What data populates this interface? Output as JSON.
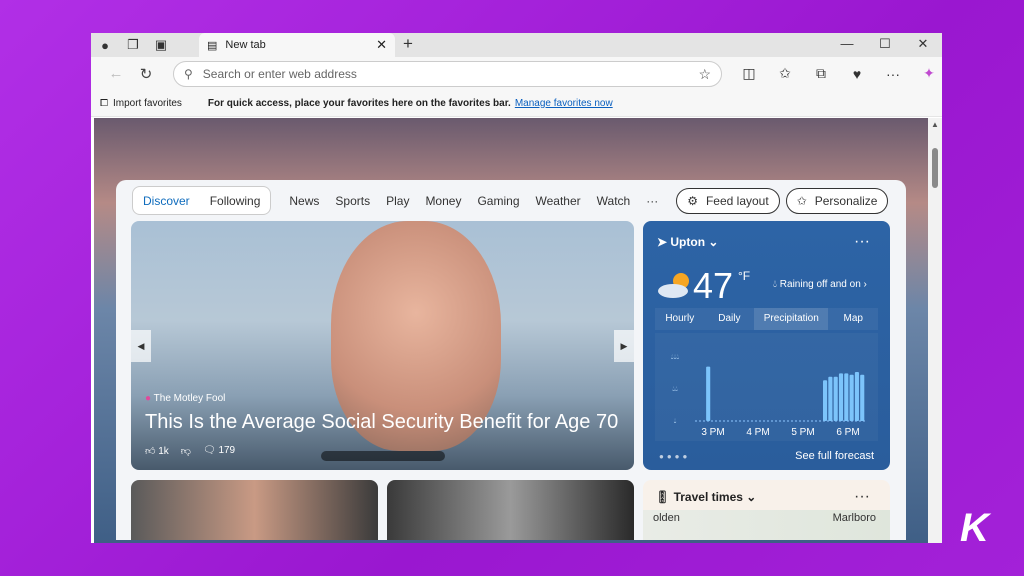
{
  "browser": {
    "tab_title": "New tab",
    "address_placeholder": "Search or enter web address",
    "favorites": {
      "import": "Import favorites",
      "hint": "For quick access, place your favorites here on the favorites bar.",
      "manage_link": "Manage favorites now"
    }
  },
  "feed": {
    "nav": {
      "discover": "Discover",
      "following": "Following",
      "items": [
        "News",
        "Sports",
        "Play",
        "Money",
        "Gaming",
        "Weather",
        "Watch",
        "···"
      ],
      "feed_layout": "Feed layout",
      "personalize": "Personalize"
    },
    "hero": {
      "source": "The Motley Fool",
      "title": "This Is the Average Social Security Benefit for Age 70",
      "likes": "1k",
      "comments": "179"
    }
  },
  "weather": {
    "location": "Upton",
    "temp": "47",
    "unit": "°F",
    "condition": "Raining off and on",
    "tabs": [
      "Hourly",
      "Daily",
      "Precipitation",
      "Map"
    ],
    "active_tab": "Precipitation",
    "more": "···",
    "footer": "See full forecast",
    "chart_data": {
      "type": "bar",
      "x_ticks": [
        "3 PM",
        "4 PM",
        "5 PM",
        "6 PM"
      ],
      "y_levels": [
        "light",
        "moderate",
        "heavy"
      ],
      "values": [
        0,
        0,
        0.8,
        0,
        0,
        0,
        0,
        0,
        0,
        0,
        0,
        0,
        0,
        0,
        0,
        0,
        0,
        0,
        0,
        0,
        0,
        0,
        0,
        0,
        0.6,
        0.65,
        0.65,
        0.7,
        0.7,
        0.68,
        0.72,
        0.68
      ]
    }
  },
  "travel": {
    "title": "Travel times",
    "more": "···",
    "map_labels": [
      "Marlboro",
      "olden"
    ]
  },
  "colors": {
    "accent": "#0f6cbd",
    "weather_bg": "#2d64a6",
    "page_bg": "#a321d8"
  }
}
